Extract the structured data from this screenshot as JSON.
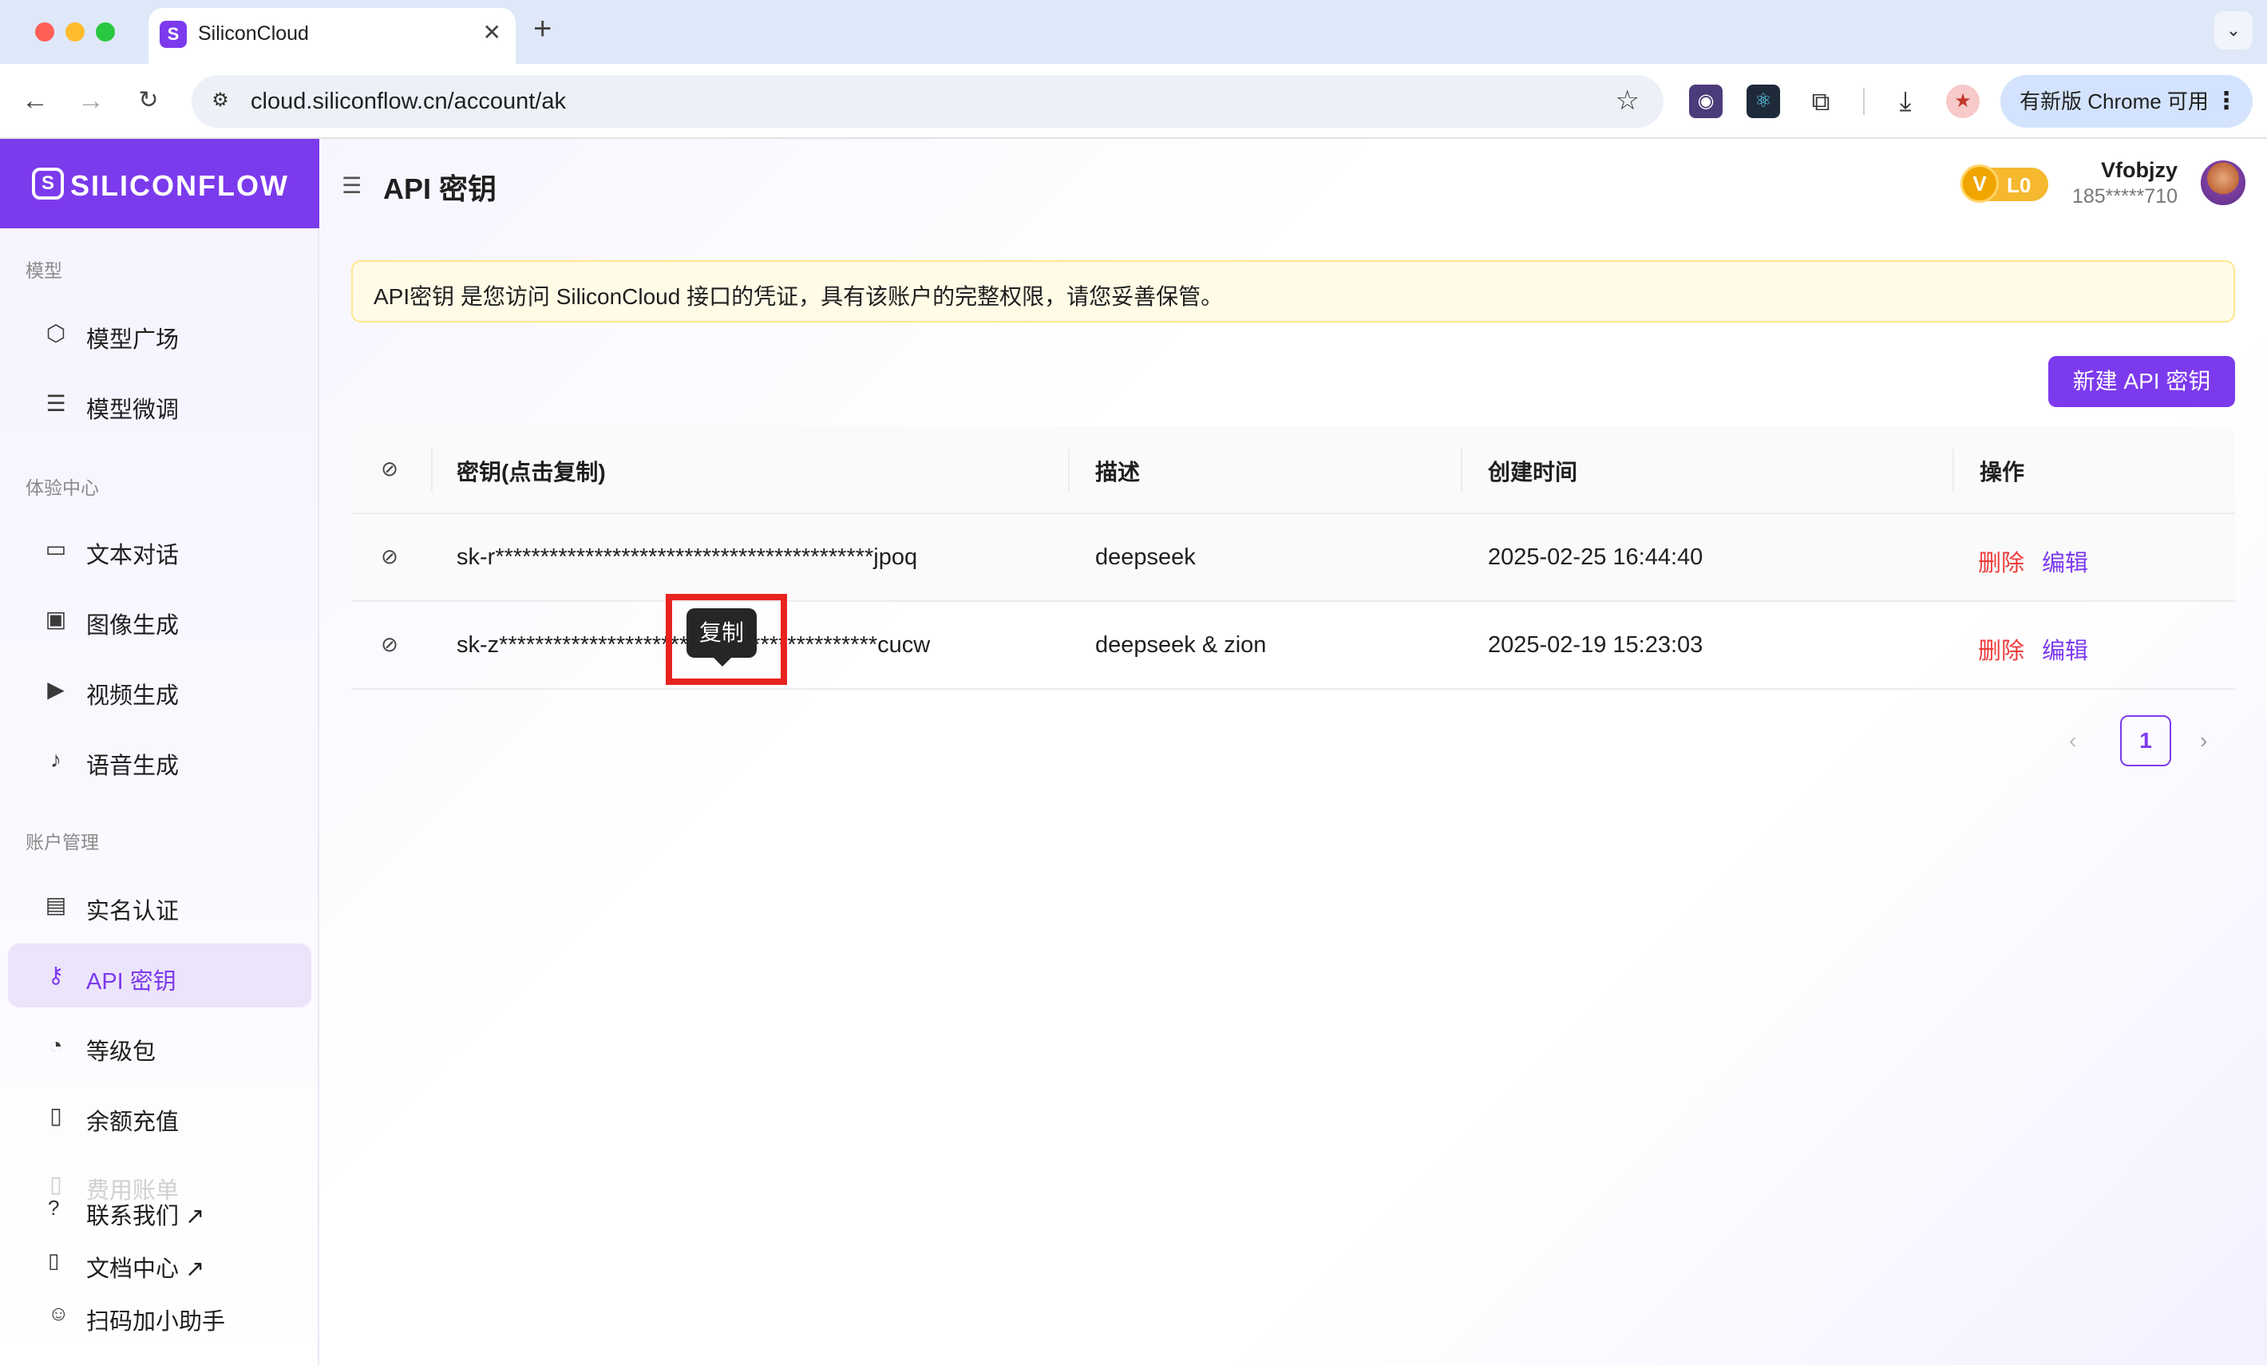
{
  "browser": {
    "tab_title": "SiliconCloud",
    "tab_close": "✕",
    "new_tab": "+",
    "tab_menu": "⌄",
    "url": "cloud.siliconflow.cn/account/ak",
    "update_label": "有新版 Chrome 可用",
    "update_menu": "⋮"
  },
  "sidebar": {
    "logo_mark": "S",
    "logo_text": "SILICONFLOW",
    "sections": [
      {
        "title": "模型",
        "items": [
          {
            "label": "模型广场",
            "icon": "cube-icon"
          },
          {
            "label": "模型微调",
            "icon": "sliders-icon"
          }
        ]
      },
      {
        "title": "体验中心",
        "items": [
          {
            "label": "文本对话",
            "icon": "chat-icon"
          },
          {
            "label": "图像生成",
            "icon": "image-icon"
          },
          {
            "label": "视频生成",
            "icon": "video-icon"
          },
          {
            "label": "语音生成",
            "icon": "mic-icon"
          }
        ]
      },
      {
        "title": "账户管理",
        "items": [
          {
            "label": "实名认证",
            "icon": "id-card-icon"
          },
          {
            "label": "API 密钥",
            "icon": "key-icon",
            "active": true
          },
          {
            "label": "等级包",
            "icon": "gauge-icon"
          },
          {
            "label": "余额充值",
            "icon": "wallet-icon"
          },
          {
            "label": "费用账单",
            "icon": "bill-icon"
          }
        ]
      }
    ],
    "footer": [
      {
        "label": "联系我们 ↗",
        "icon": "question-icon"
      },
      {
        "label": "文档中心 ↗",
        "icon": "book-icon"
      },
      {
        "label": "扫码加小助手",
        "icon": "users-icon"
      }
    ]
  },
  "header": {
    "title": "API 密钥",
    "vip_mark": "V",
    "level": "L0",
    "user_name": "Vfobjzy",
    "user_phone": "185*****710"
  },
  "notice": "API密钥 是您访问 SiliconCloud 接口的凭证，具有该账户的完整权限，请您妥善保管。",
  "create_button": "新建 API 密钥",
  "table": {
    "columns": [
      "密钥(点击复制)",
      "描述",
      "创建时间",
      "操作"
    ],
    "rows": [
      {
        "key": "sk-r******************************************jpoq",
        "description": "deepseek",
        "created": "2025-02-25 16:44:40",
        "delete": "删除",
        "edit": "编辑"
      },
      {
        "key": "sk-z******************************************cucw",
        "description": "deepseek & zion",
        "created": "2025-02-19 15:23:03",
        "delete": "删除",
        "edit": "编辑"
      }
    ]
  },
  "tooltip": "复制",
  "pagination": {
    "prev": "‹",
    "current": "1",
    "next": "›"
  },
  "colors": {
    "accent": "#7c3aed",
    "danger": "#ef3b3b",
    "notice_bg": "#fffbe6",
    "highlight_box": "#e8231f"
  }
}
